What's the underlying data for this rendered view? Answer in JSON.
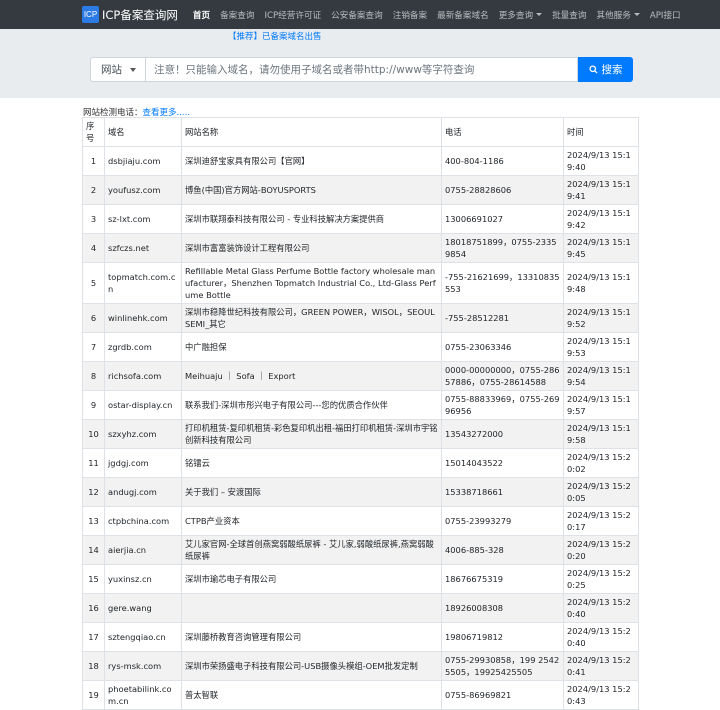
{
  "brand": {
    "logo_text": "ICP",
    "name": "ICP备案查询网"
  },
  "nav": [
    {
      "label": "首页",
      "active": true,
      "dropdown": false
    },
    {
      "label": "备案查询",
      "active": false,
      "dropdown": false
    },
    {
      "label": "ICP经营许可证",
      "active": false,
      "dropdown": false
    },
    {
      "label": "公安备案查询",
      "active": false,
      "dropdown": false
    },
    {
      "label": "注销备案",
      "active": false,
      "dropdown": false
    },
    {
      "label": "最新备案域名",
      "active": false,
      "dropdown": false
    },
    {
      "label": "更多查询",
      "active": false,
      "dropdown": true
    },
    {
      "label": "批量查询",
      "active": false,
      "dropdown": false
    },
    {
      "label": "其他服务",
      "active": false,
      "dropdown": true
    },
    {
      "label": "API接口",
      "active": false,
      "dropdown": false
    }
  ],
  "recommend_text": "【推荐】已备案域名出售",
  "search": {
    "select_value": "网站",
    "placeholder": "注意！只能输入域名，请勿使用子域名或者带http://www等字符查询",
    "button_label": "搜索"
  },
  "info": {
    "label": "网站检测电话：",
    "link": "查看更多....."
  },
  "table": {
    "headers": [
      "序号",
      "域名",
      "网站名称",
      "电话",
      "时间"
    ],
    "rows": [
      [
        "1",
        "dsbjiaju.com",
        "深圳迪舒宝家具有限公司【官网】",
        "400-804-1186",
        "2024/9/13 15:19:40"
      ],
      [
        "2",
        "youfusz.com",
        "博鱼(中国)官方网站-BOYUSPORTS",
        "0755-28828606",
        "2024/9/13 15:19:41"
      ],
      [
        "3",
        "sz-lxt.com",
        "深圳市联翔泰科技有限公司 - 专业科技解决方案提供商",
        "13006691027",
        "2024/9/13 15:19:42"
      ],
      [
        "4",
        "szfczs.net",
        "深圳市富富装饰设计工程有限公司",
        "18018751899，0755-23359854",
        "2024/9/13 15:19:45"
      ],
      [
        "5",
        "topmatch.com.cn",
        "Refillable Metal Glass Perfume Bottle factory wholesale manufacturer，Shenzhen Topmatch Industrial Co., Ltd-Glass Perfume Bottle",
        "-755-21621699，13310835553",
        "2024/9/13 15:19:48"
      ],
      [
        "6",
        "winlinehk.com",
        "深圳市稳降世纪科技有限公司，GREEN POWER，WISOL，SEOUL SEMI_其它",
        "-755-28512281",
        "2024/9/13 15:19:52"
      ],
      [
        "7",
        "zgrdb.com",
        "中广融担保",
        "0755-23063346",
        "2024/9/13 15:19:53"
      ],
      [
        "8",
        "richsofa.com",
        "Meihuaju ｜ Sofa ｜ Export",
        "0000-00000000，0755-28657886，0755-28614588",
        "2024/9/13 15:19:54"
      ],
      [
        "9",
        "ostar-display.cn",
        "联系我们-深圳市彤兴电子有限公司---您的优质合作伙伴",
        "0755-88833969，0755-26996956",
        "2024/9/13 15:19:57"
      ],
      [
        "10",
        "szxyhz.com",
        "打印机租赁-复印机租赁-彩色复印机出租-福田打印机租赁-深圳市宇铭创新科技有限公司",
        "13543272000",
        "2024/9/13 15:19:58"
      ],
      [
        "11",
        "jgdgj.com",
        "铭镭云",
        "15014043522",
        "2024/9/13 15:20:02"
      ],
      [
        "12",
        "andugj.com",
        "关于我们 – 安渡国际",
        "15338718661",
        "2024/9/13 15:20:05"
      ],
      [
        "13",
        "ctpbchina.com",
        "CTPB产业资本",
        "0755-23993279",
        "2024/9/13 15:20:17"
      ],
      [
        "14",
        "aierjia.cn",
        "艾儿家官网-全球首创燕窝弱酸纸尿裤 - 艾儿家,弱酸纸尿裤,燕窝弱酸纸尿裤",
        "4006-885-328",
        "2024/9/13 15:20:20"
      ],
      [
        "15",
        "yuxinsz.cn",
        "深圳市瑜芯电子有限公司",
        "18676675319",
        "2024/9/13 15:20:25"
      ],
      [
        "16",
        "gere.wang",
        "",
        "18926008308",
        "2024/9/13 15:20:40"
      ],
      [
        "17",
        "sztengqiao.cn",
        "深圳藤桥教育咨询管理有限公司",
        "19806719812",
        "2024/9/13 15:20:40"
      ],
      [
        "18",
        "rys-msk.com",
        "深圳市荣扬盛电子科技有限公司-USB摄像头模组-OEM批发定制",
        "0755-29930858，199 2542 5505，19925425505",
        "2024/9/13 15:20:41"
      ],
      [
        "19",
        "phoetabilink.com.cn",
        "普太智联",
        "0755-86969821",
        "2024/9/13 15:20:43"
      ]
    ]
  }
}
